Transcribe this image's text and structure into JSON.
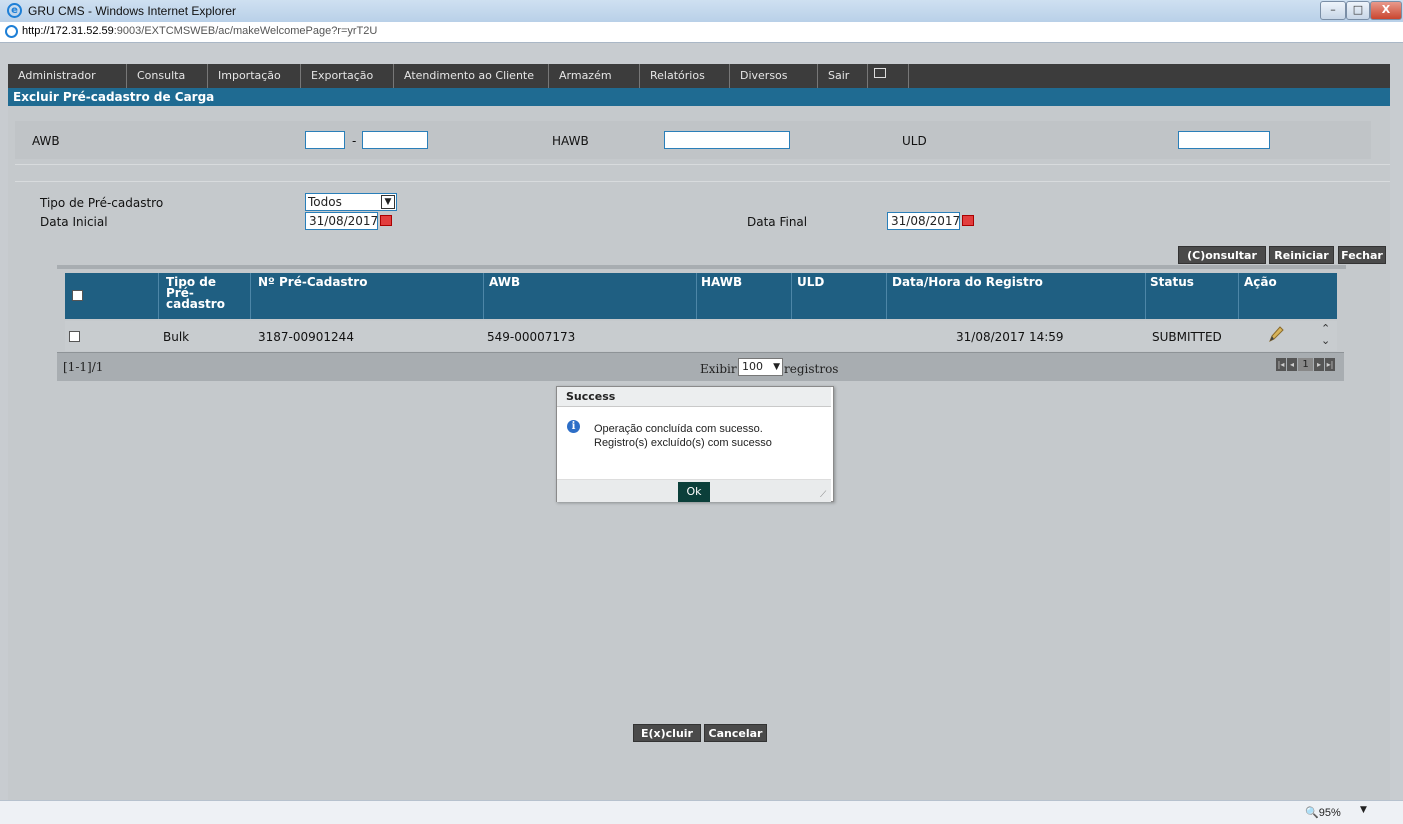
{
  "window": {
    "title": "GRU CMS - Windows Internet Explorer",
    "url_host": "http://172.31.52.59",
    "url_path": ":9003/EXTCMSWEB/ac/makeWelcomePage?r=yrT2U",
    "minimize": "–",
    "maximize": "□",
    "close": "X"
  },
  "menu": [
    "Administrador",
    "Consulta",
    "Importação",
    "Exportação",
    "Atendimento ao Cliente",
    "Armazém",
    "Relatórios",
    "Diversos",
    "Sair"
  ],
  "page": {
    "title": "Excluir Pré-cadastro de Carga"
  },
  "search": {
    "awb_label": "AWB",
    "awb_sep": "-",
    "hawb_label": "HAWB",
    "uld_label": "ULD",
    "awb_prefix": "",
    "awb_number": "",
    "hawb_value": "",
    "uld_value": ""
  },
  "filters": {
    "tipo_label": "Tipo de Pré-cadastro",
    "tipo_value": "Todos",
    "data_inicial_label": "Data Inicial",
    "data_inicial_value": "31/08/2017",
    "data_final_label": "Data Final",
    "data_final_value": "31/08/2017"
  },
  "actions": {
    "consultar": "(C)onsultar",
    "reiniciar": "Reiniciar",
    "fechar": "Fechar",
    "excluir": "E(x)cluir",
    "cancelar": "Cancelar"
  },
  "table": {
    "headers": {
      "tipo": "Tipo de Pré- cadastro",
      "numero": "Nº Pré-Cadastro",
      "awb": "AWB",
      "hawb": "HAWB",
      "uld": "ULD",
      "data_hora": "Data/Hora do Registro",
      "status": "Status",
      "acao": "Ação"
    },
    "rows": [
      {
        "tipo": "Bulk",
        "numero": "3187-00901244",
        "awb": "549-00007173",
        "hawb": "",
        "uld": "",
        "data_hora": "31/08/2017 14:59",
        "status": "SUBMITTED"
      }
    ],
    "range": "[1-1]/1",
    "exibir": "Exibir",
    "page_size": "100",
    "registros": "registros",
    "current_page": "1"
  },
  "dialog": {
    "title": "Success",
    "line1": "Operação concluída com sucesso.",
    "line2": "Registro(s) excluído(s) com sucesso",
    "ok": "Ok"
  },
  "statusbar": {
    "zoom": "95%"
  },
  "colors": {
    "header_blue": "#1f5f82",
    "page_head_blue": "#1f6b92",
    "menubar": "#3c3c3c",
    "ok_button": "#0b3f3a"
  }
}
